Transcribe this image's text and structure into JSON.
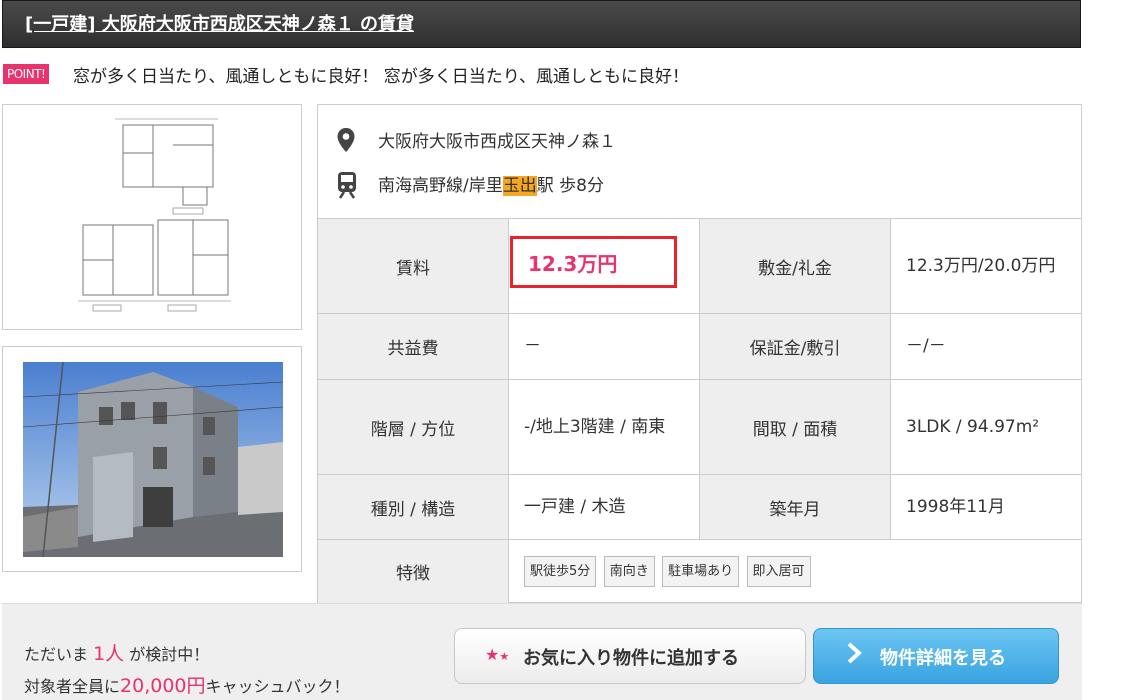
{
  "title": "[一戸建] 大阪府大阪市西成区天神ノ森１ の賃貸",
  "point": {
    "badge": "POINT!",
    "text": "窓が多く日当たり、風通しともに良好！ 窓が多く日当たり、風通しともに良好！"
  },
  "address": "大阪府大阪市西成区天神ノ森１",
  "access": {
    "before": "南海高野線/岸里",
    "highlight": "玉出",
    "after": "駅 歩8分"
  },
  "icons": {
    "location": "map-pin-icon",
    "train": "train-icon",
    "favorite": "star-icon",
    "detail": "chevron-right-icon"
  },
  "spec": {
    "rent_label": "賃料",
    "rent": "12.3万円",
    "deposit_label": "敷金/礼金",
    "deposit": "12.3万円/20.0万円",
    "common_label": "共益費",
    "common": "－",
    "guarantee_label": "保証金/敷引",
    "guarantee": "－/－",
    "floor_label": "階層 / 方位",
    "floor": "-/地上3階建 / 南東",
    "layout_label": "間取 / 面積",
    "layout": "3LDK / 94.97m²",
    "type_label": "種別 / 構造",
    "type": "一戸建 / 木造",
    "built_label": "築年月",
    "built": "1998年11月",
    "features_label": "特徴",
    "features": [
      "駅徒歩5分",
      "南向き",
      "駐車場あり",
      "即入居可"
    ]
  },
  "footer": {
    "viewing_prefix": "ただいま ",
    "viewing_count": "1人",
    "viewing_suffix": " が検討中！",
    "cashback_prefix": "対象者全員に",
    "cashback_amount": "20,000円",
    "cashback_suffix": "キャッシュバック！",
    "favorite_button": "お気に入り物件に追加する",
    "detail_button": "物件詳細を見る"
  },
  "colors": {
    "accent": "#e8336d",
    "highlight": "#f5a623",
    "button_blue": "#3aa3e0"
  }
}
